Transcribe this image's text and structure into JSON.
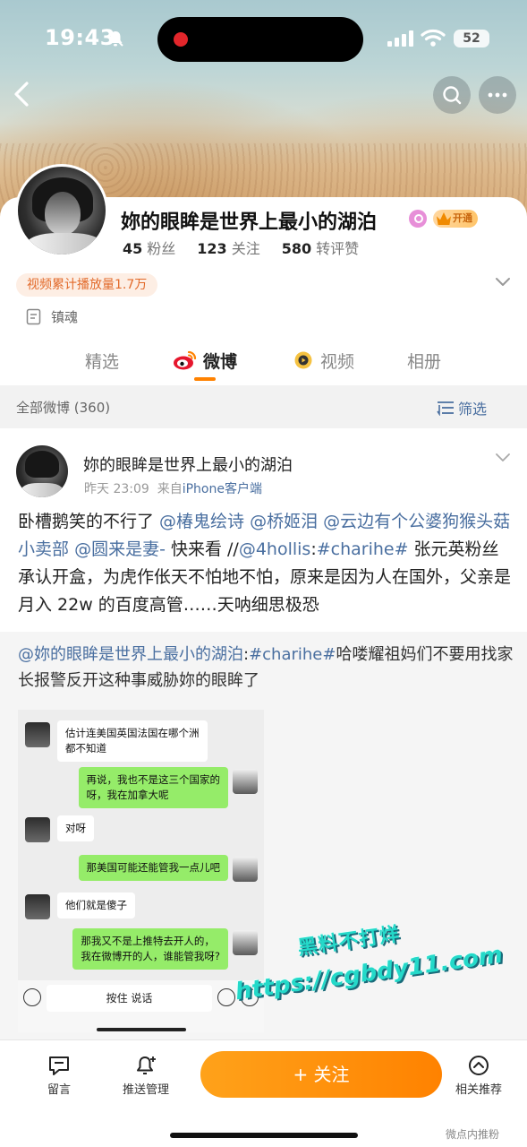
{
  "status_bar": {
    "time": "19:43",
    "battery": "52"
  },
  "profile": {
    "name": "妳的眼眸是世界上最小的湖泊",
    "vip_label": "开通",
    "stats": [
      {
        "value": "45",
        "label": "粉丝"
      },
      {
        "value": "123",
        "label": "关注"
      },
      {
        "value": "580",
        "label": "转评赞"
      }
    ],
    "video_plays": "视频累计播放量1.7万",
    "bio": "镇魂"
  },
  "tabs": [
    {
      "label": "精选"
    },
    {
      "label": "微博"
    },
    {
      "label": "视频"
    },
    {
      "label": "相册"
    }
  ],
  "filter": {
    "all_label": "全部微博 (360)",
    "filter_label": "筛选"
  },
  "post": {
    "author": "妳的眼眸是世界上最小的湖泊",
    "time": "昨天 23:09",
    "source_prefix": "来自",
    "source": "iPhone客户端",
    "body": [
      {
        "t": "卧槽鹅笑的不行了 ",
        "link": false
      },
      {
        "t": "@椿鬼绘诗",
        "link": true
      },
      {
        "t": " ",
        "link": false
      },
      {
        "t": "@桥姬泪",
        "link": true
      },
      {
        "t": " ",
        "link": false
      },
      {
        "t": "@云边有个公婆狗猴头菇小卖部",
        "link": true
      },
      {
        "t": " ",
        "link": false
      },
      {
        "t": "@圆来是妻-",
        "link": true
      },
      {
        "t": " 快来看 //",
        "link": false
      },
      {
        "t": "@4hollis",
        "link": true
      },
      {
        "t": ":",
        "link": false
      },
      {
        "t": "#charihe#",
        "link": true
      },
      {
        "t": " 张元英粉丝承认开盒，为虎作伥天不怕地不怕，原来是因为人在国外，父亲是月入 22w 的百度高管……天呐细思极恐",
        "link": false
      }
    ],
    "repost": [
      {
        "t": "@妳的眼眸是世界上最小的湖泊",
        "link": true
      },
      {
        "t": ":",
        "link": false
      },
      {
        "t": "#charihe#",
        "link": true
      },
      {
        "t": "哈喽耀祖妈们不要用找家长报警反开这种事威胁妳的眼眸了",
        "link": false
      }
    ]
  },
  "chat": {
    "messages": [
      {
        "side": "in",
        "lines": [
          "估计连美国英国法国在哪个洲",
          "都不知道"
        ]
      },
      {
        "side": "out",
        "lines": [
          "再说，我也不是这三个国家的",
          "呀，我在加拿大呢"
        ]
      },
      {
        "side": "in",
        "lines": [
          "对呀"
        ]
      },
      {
        "side": "out",
        "lines": [
          "那美国可能还能管我一点儿吧"
        ]
      },
      {
        "side": "in",
        "lines": [
          "他们就是傻子"
        ]
      },
      {
        "side": "out",
        "lines": [
          "那我又不是上推特去开人的，",
          "我在微博开的人，谁能管我呀?"
        ]
      }
    ],
    "hold_to_talk": "按住 说话"
  },
  "watermark": {
    "line1": "黑料不打烊",
    "line2": "https://cgbdy11.com"
  },
  "bottom_bar": {
    "comment": "留言",
    "push": "推送管理",
    "follow": "+ 关注",
    "related": "相关推荐",
    "corner": "微点内推粉"
  },
  "colors": {
    "accent": "#ff8200",
    "link": "#4a6fa0"
  }
}
